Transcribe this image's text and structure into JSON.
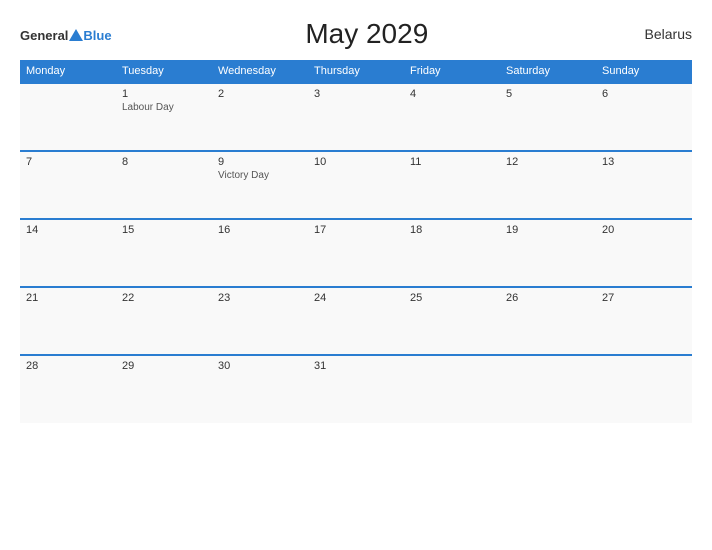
{
  "header": {
    "logo_general": "General",
    "logo_blue": "Blue",
    "title": "May 2029",
    "country": "Belarus"
  },
  "calendar": {
    "weekdays": [
      "Monday",
      "Tuesday",
      "Wednesday",
      "Thursday",
      "Friday",
      "Saturday",
      "Sunday"
    ],
    "weeks": [
      [
        {
          "day": "",
          "holiday": ""
        },
        {
          "day": "1",
          "holiday": "Labour Day"
        },
        {
          "day": "2",
          "holiday": ""
        },
        {
          "day": "3",
          "holiday": ""
        },
        {
          "day": "4",
          "holiday": ""
        },
        {
          "day": "5",
          "holiday": ""
        },
        {
          "day": "6",
          "holiday": ""
        }
      ],
      [
        {
          "day": "7",
          "holiday": ""
        },
        {
          "day": "8",
          "holiday": ""
        },
        {
          "day": "9",
          "holiday": "Victory Day"
        },
        {
          "day": "10",
          "holiday": ""
        },
        {
          "day": "11",
          "holiday": ""
        },
        {
          "day": "12",
          "holiday": ""
        },
        {
          "day": "13",
          "holiday": ""
        }
      ],
      [
        {
          "day": "14",
          "holiday": ""
        },
        {
          "day": "15",
          "holiday": ""
        },
        {
          "day": "16",
          "holiday": ""
        },
        {
          "day": "17",
          "holiday": ""
        },
        {
          "day": "18",
          "holiday": ""
        },
        {
          "day": "19",
          "holiday": ""
        },
        {
          "day": "20",
          "holiday": ""
        }
      ],
      [
        {
          "day": "21",
          "holiday": ""
        },
        {
          "day": "22",
          "holiday": ""
        },
        {
          "day": "23",
          "holiday": ""
        },
        {
          "day": "24",
          "holiday": ""
        },
        {
          "day": "25",
          "holiday": ""
        },
        {
          "day": "26",
          "holiday": ""
        },
        {
          "day": "27",
          "holiday": ""
        }
      ],
      [
        {
          "day": "28",
          "holiday": ""
        },
        {
          "day": "29",
          "holiday": ""
        },
        {
          "day": "30",
          "holiday": ""
        },
        {
          "day": "31",
          "holiday": ""
        },
        {
          "day": "",
          "holiday": ""
        },
        {
          "day": "",
          "holiday": ""
        },
        {
          "day": "",
          "holiday": ""
        }
      ]
    ]
  }
}
